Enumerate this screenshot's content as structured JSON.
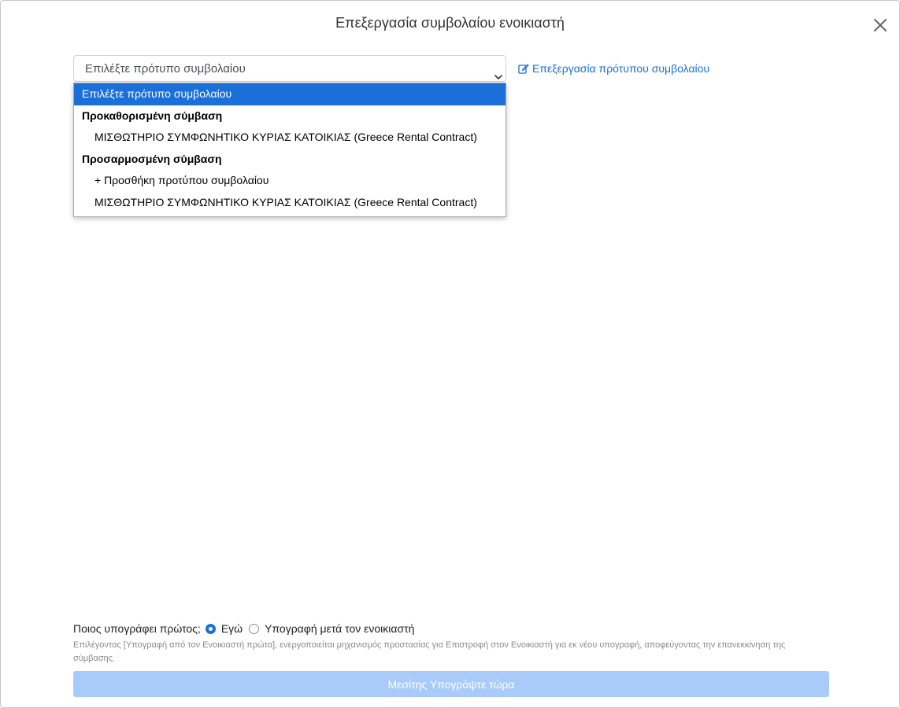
{
  "modal": {
    "title": "Επεξεργασία συμβολαίου ενοικιαστή",
    "close_icon": "close-icon"
  },
  "template_select": {
    "value": "Επιλέξτε πρότυπο συμβολαίου",
    "edit_link_label": "Επεξεργασία πρότυπου συμβολαίου"
  },
  "dropdown": {
    "selected_item": "Επιλέξτε πρότυπο συμβολαίου",
    "group_predefined": "Προκαθορισμένη σύμβαση",
    "predefined_option_1": "ΜΙΣΘΩΤΗΡΙΟ ΣΥΜΦΩΝΗΤΙΚΟ ΚΥΡΙΑΣ ΚΑΤΟΙΚΙΑΣ (Greece Rental Contract)",
    "group_custom": "Προσαρμοσμένη σύμβαση",
    "custom_option_add": "+ Προσθήκη προτύπου συμβολαίου",
    "custom_option_1": "ΜΙΣΘΩΤΗΡΙΟ ΣΥΜΦΩΝΗΤΙΚΟ ΚΥΡΙΑΣ ΚΑΤΟΙΚΙΑΣ (Greece Rental Contract)"
  },
  "signer": {
    "question": "Ποιος υπογράφει πρώτος;",
    "option_me": "Εγώ",
    "option_after_tenant": "Υπογραφή μετά τον ενοικιαστή",
    "selected": "Εγώ",
    "note": "Επιλέγοντας [Υπογραφή από τον Ενοικιαστή πρώτα], ενεργοποιείται μηχανισμός προστασίας για Επιστροφή στον Ενοικιαστή για εκ νέου υπογραφή, αποφεύγοντας την επανεκκίνηση της σύμβασης."
  },
  "actions": {
    "sign_now_label": "Μεσίτης Υπογράψτε τώρα"
  },
  "colors": {
    "accent": "#1a6fd8",
    "link": "#1a6fd1",
    "disabled_button": "#a9cbf9"
  }
}
